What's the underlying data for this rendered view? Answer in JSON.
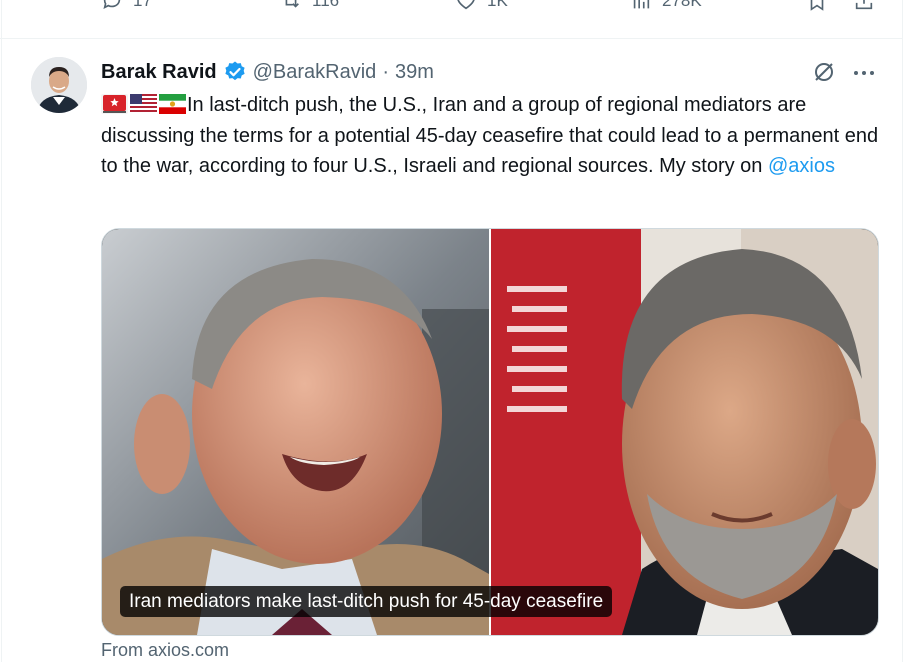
{
  "previous_post": {
    "reply_count": "17",
    "repost_count": "116",
    "like_count": "1K",
    "view_count": "278K"
  },
  "post": {
    "author_name": "Barak Ravid",
    "author_handle": "@BarakRavid",
    "separator": "·",
    "timestamp": "39m",
    "text_main": "In last-ditch push, the U.S., Iran and a group of regional mediators are discussing the terms for a potential 45-day ceasefire that could lead to a permanent end to the war, according to four U.S., Israeli and regional sources. My story on ",
    "mention": "@axios",
    "flags": [
      "red-shield-flag",
      "us-flag",
      "iran-lion-sun-flag"
    ],
    "link_card": {
      "caption": "Iran mediators make last-ditch push for 45-day ceasefire",
      "source": "From axios.com"
    }
  },
  "colors": {
    "accent": "#1d9bf0",
    "text": "#0f1419",
    "secondary": "#536471"
  },
  "icons": {
    "reply": "reply-icon",
    "repost": "repost-icon",
    "like": "like-icon",
    "views": "views-icon",
    "bookmark": "bookmark-icon",
    "share": "share-icon",
    "grok": "grok-icon",
    "more": "more-icon",
    "verified": "verified-badge-icon"
  }
}
